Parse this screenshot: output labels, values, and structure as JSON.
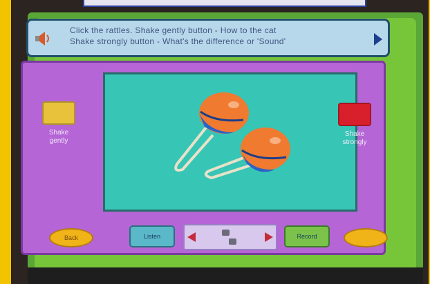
{
  "instruction": {
    "line1": "Click the rattles. Shake gently button - How to the cat",
    "line2": "Shake strongly button - What's the difference or 'Sound'"
  },
  "left_side": {
    "label_line1": "Shake",
    "label_line2": "gently",
    "color": "#e8c23a"
  },
  "right_side": {
    "label_line1": "Shake",
    "label_line2": "strongly",
    "color": "#d81f2c"
  },
  "bottom": {
    "left_oval": "Back",
    "teal_button": "Listen",
    "green_button": "Record",
    "right_oval": ""
  },
  "colors": {
    "screen_green": "#77c63a",
    "purple": "#b565d6",
    "stage_teal": "#37c5b5",
    "instruction_bg": "#b7d7ea",
    "maraca_orange": "#f07a30",
    "maraca_blue": "#2a62c8"
  },
  "icons": {
    "speaker": "speaker-icon",
    "next": "next-arrow-icon",
    "maracas": "maracas-illustration",
    "pager_prev": "prev-arrow-icon",
    "pager_next": "next-page-arrow-icon"
  }
}
